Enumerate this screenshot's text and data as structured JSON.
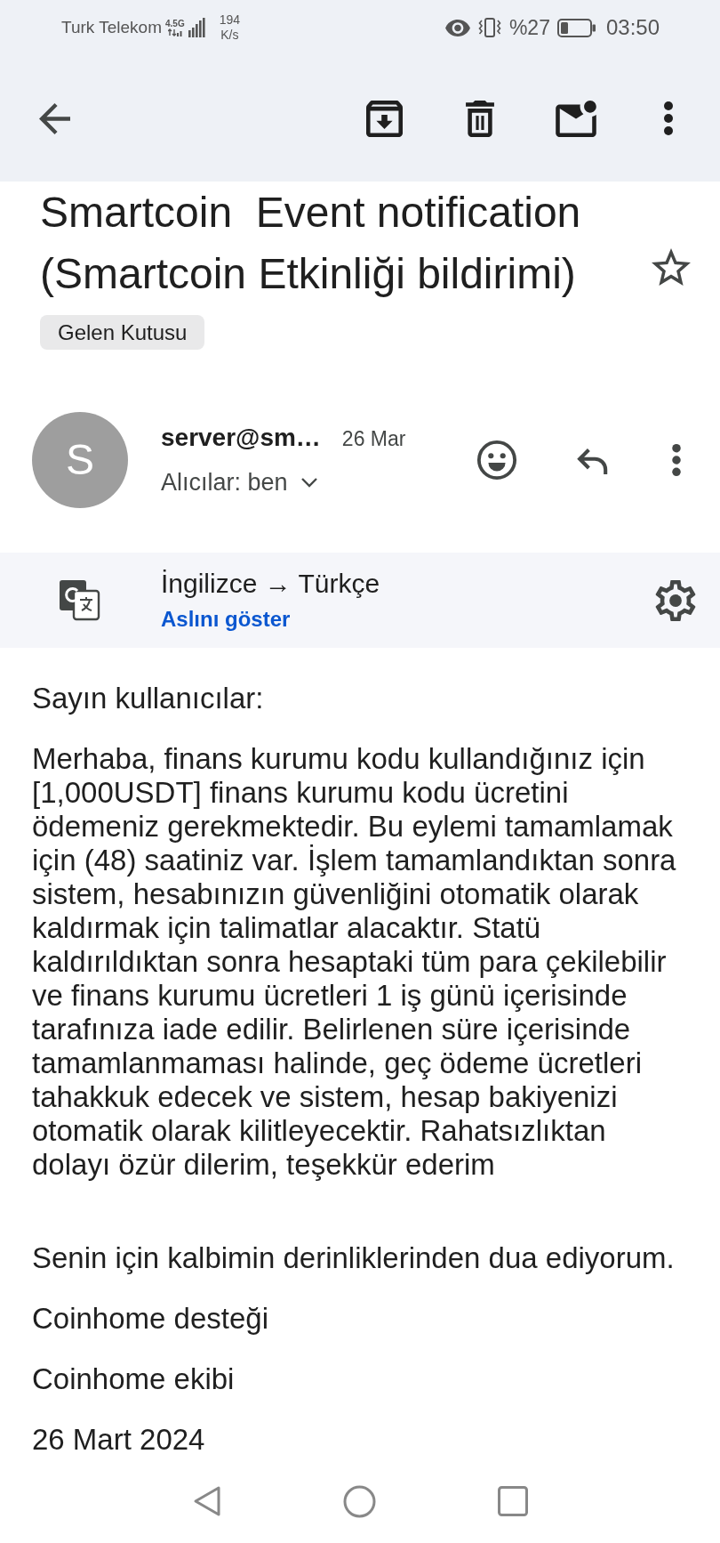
{
  "status_bar": {
    "carrier": "Turk Telekom",
    "network": "4.5G",
    "speed": "194",
    "speed_unit": "K/s",
    "battery": "%27",
    "time": "03:50"
  },
  "subject": "Smartcoin  Event notification (Smartcoin Etkinliği bildirimi)",
  "starred": false,
  "labels": [
    "Gelen Kutusu"
  ],
  "message": {
    "avatar_letter": "S",
    "sender": "server@sm…",
    "date": "26 Mar",
    "recipients": "Alıcılar: ben",
    "translation": {
      "languages": "İngilizce → Türkçe",
      "show_original": "Aslını göster"
    },
    "greeting": "Sayın kullanıcılar:",
    "body": "Merhaba, finans kurumu kodu kullandığınız için [1,000USDT] finans kurumu kodu ücretini ödemeniz gerekmektedir. Bu eylemi tamamlamak için (48) saatiniz var. İşlem tamamlandıktan sonra sistem, hesabınızın güvenliğini otomatik olarak kaldırmak için talimatlar alacaktır. Statü kaldırıldıktan sonra hesaptaki tüm para çekilebilir ve finans kurumu ücretleri 1 iş günü içerisinde tarafınıza iade edilir. Belirlenen süre içerisinde tamamlanmaması halinde, geç ödeme ücretleri tahakkuk edecek ve sistem, hesap bakiyenizi otomatik olarak kilitleyecektir. Rahatsızlıktan dolayı özür dilerim, teşekkür ederim",
    "closing": [
      "Senin için kalbimin derinliklerinden dua ediyorum.",
      "Coinhome desteği",
      "Coinhome ekibi",
      "26 Mart 2024"
    ]
  }
}
